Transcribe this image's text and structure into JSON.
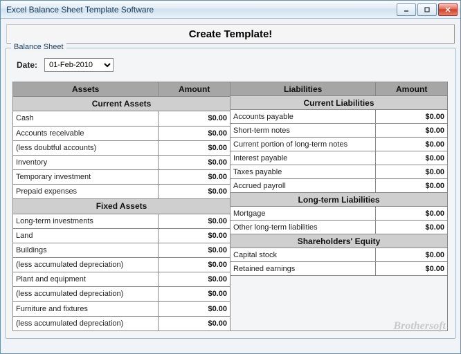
{
  "window": {
    "title": "Excel Balance Sheet Template Software"
  },
  "create_button": "Create Template!",
  "fieldset_legend": "Balance Sheet",
  "date": {
    "label": "Date:",
    "value": "01-Feb-2010"
  },
  "headers": {
    "assets": "Assets",
    "amount": "Amount",
    "liabilities": "Liabilities"
  },
  "sections": {
    "current_assets": "Current Assets",
    "fixed_assets": "Fixed Assets",
    "current_liabilities": "Current Liabilities",
    "long_term_liabilities": "Long-term Liabilities",
    "shareholders_equity": "Shareholders' Equity"
  },
  "assets": {
    "current": [
      {
        "label": "Cash",
        "amount": "$0.00"
      },
      {
        "label": "Accounts receivable",
        "amount": "$0.00"
      },
      {
        "label": "(less doubtful accounts)",
        "amount": "$0.00"
      },
      {
        "label": "Inventory",
        "amount": "$0.00"
      },
      {
        "label": "Temporary investment",
        "amount": "$0.00"
      },
      {
        "label": "Prepaid expenses",
        "amount": "$0.00"
      }
    ],
    "fixed": [
      {
        "label": "Long-term investments",
        "amount": "$0.00"
      },
      {
        "label": "Land",
        "amount": "$0.00"
      },
      {
        "label": "Buildings",
        "amount": "$0.00"
      },
      {
        "label": "(less accumulated depreciation)",
        "amount": "$0.00"
      },
      {
        "label": "Plant and equipment",
        "amount": "$0.00"
      },
      {
        "label": "(less accumulated depreciation)",
        "amount": "$0.00"
      },
      {
        "label": "Furniture and fixtures",
        "amount": "$0.00"
      },
      {
        "label": "(less accumulated depreciation)",
        "amount": "$0.00"
      }
    ]
  },
  "liabilities": {
    "current": [
      {
        "label": "Accounts payable",
        "amount": "$0.00"
      },
      {
        "label": "Short-term notes",
        "amount": "$0.00"
      },
      {
        "label": "Current portion of long-term notes",
        "amount": "$0.00"
      },
      {
        "label": "Interest payable",
        "amount": "$0.00"
      },
      {
        "label": "Taxes payable",
        "amount": "$0.00"
      },
      {
        "label": "Accrued payroll",
        "amount": "$0.00"
      }
    ],
    "long_term": [
      {
        "label": "Mortgage",
        "amount": "$0.00"
      },
      {
        "label": "Other long-term liabilities",
        "amount": "$0.00"
      }
    ],
    "equity": [
      {
        "label": "Capital stock",
        "amount": "$0.00"
      },
      {
        "label": "Retained earnings",
        "amount": "$0.00"
      }
    ]
  },
  "watermark": "Brothersoft"
}
